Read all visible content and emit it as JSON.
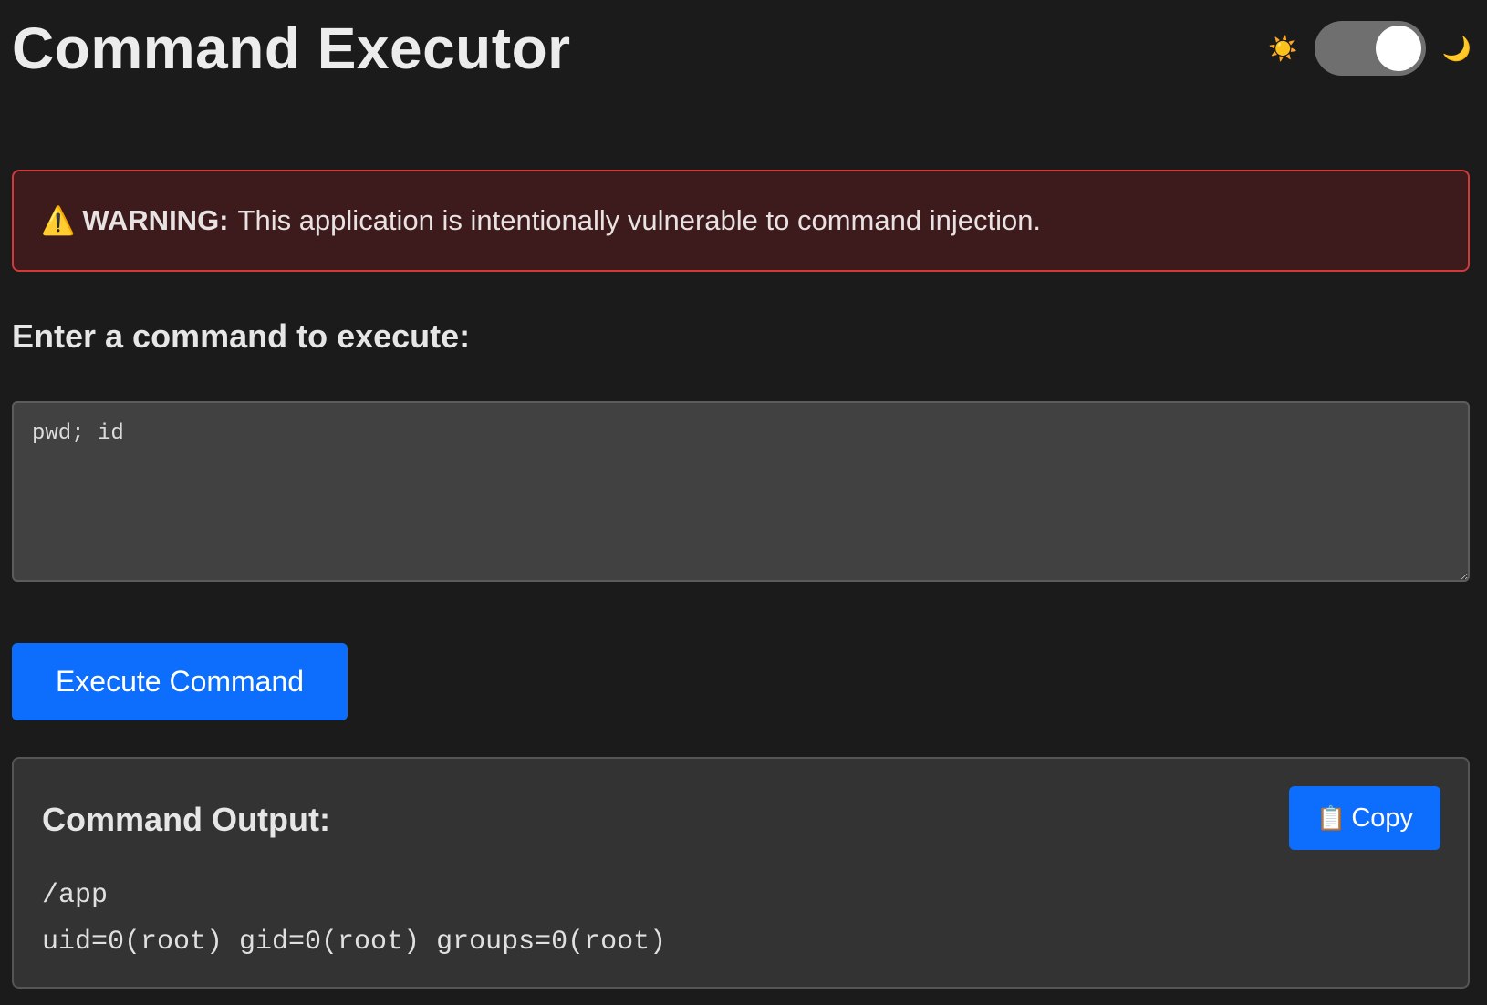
{
  "header": {
    "title": "Command Executor",
    "theme_toggle": {
      "light_icon": "sun-icon",
      "dark_icon": "moon-icon",
      "light_glyph": "☀️",
      "dark_glyph": "🌙",
      "state": "dark"
    }
  },
  "warning": {
    "icon": "warning-icon",
    "icon_glyph": "⚠️",
    "label": "WARNING:",
    "message": "This application is intentionally vulnerable to command injection."
  },
  "form": {
    "prompt": "Enter a command to execute:",
    "command_value": "pwd; id",
    "execute_label": "Execute Command"
  },
  "output": {
    "title": "Command Output:",
    "copy_icon": "clipboard-icon",
    "copy_glyph": "📋",
    "copy_label": "Copy",
    "lines": [
      "/app",
      "uid=0(root) gid=0(root) groups=0(root)"
    ]
  },
  "colors": {
    "background": "#1b1b1b",
    "accent": "#0d6efd",
    "warning_border": "#d23a3a",
    "warning_bg": "#3d1a1b"
  }
}
